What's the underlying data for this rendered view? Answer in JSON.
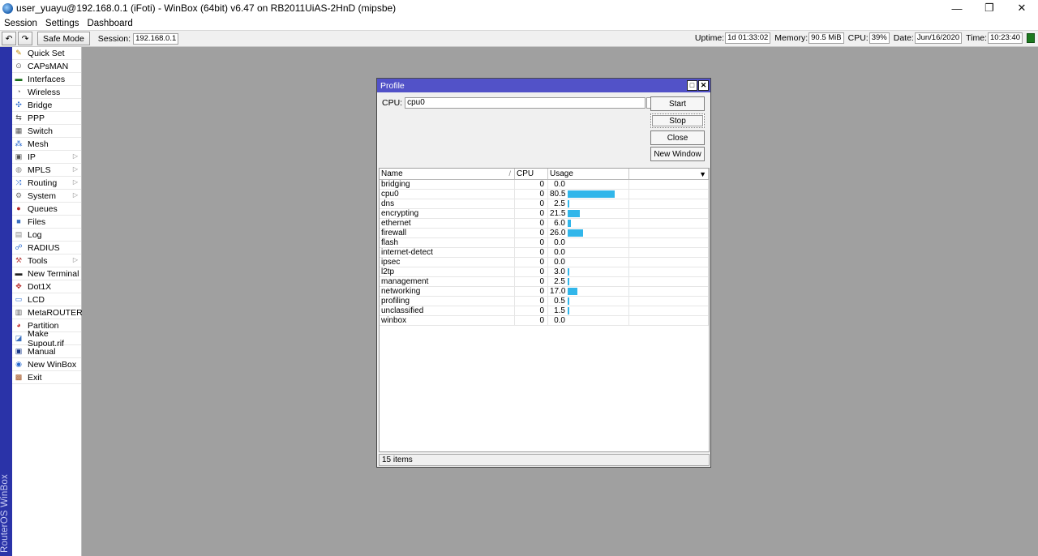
{
  "window": {
    "title": "user_yuayu@192.168.0.1 (iFoti) - WinBox (64bit) v6.47 on RB2011UiAS-2HnD (mipsbe)",
    "minimize": "—",
    "restore": "❐",
    "close": "✕"
  },
  "menu": [
    "Session",
    "Settings",
    "Dashboard"
  ],
  "toolbar": {
    "undo": "↶",
    "redo": "↷",
    "safe_mode": "Safe Mode",
    "session_label": "Session:",
    "session_value": "192.168.0.1",
    "uptime_label": "Uptime:",
    "uptime_value": "1d 01:33:02",
    "memory_label": "Memory:",
    "memory_value": "90.5 MiB",
    "cpu_label": "CPU:",
    "cpu_value": "39%",
    "date_label": "Date:",
    "date_value": "Jun/16/2020",
    "time_label": "Time:",
    "time_value": "10:23:40",
    "status_color": "#1d7a20"
  },
  "brand": "RouterOS WinBox",
  "sidebar": {
    "items": [
      {
        "label": "Quick Set",
        "icon": "wand-icon",
        "glyph": "✎",
        "color": "#c08a00",
        "submenu": false
      },
      {
        "label": "CAPsMAN",
        "icon": "antenna-icon",
        "glyph": "⊙",
        "color": "#666",
        "submenu": false
      },
      {
        "label": "Interfaces",
        "icon": "ethernet-icon",
        "glyph": "▬",
        "color": "#1a6e1a",
        "submenu": false
      },
      {
        "label": "Wireless",
        "icon": "wireless-icon",
        "glyph": "◔",
        "color": "#666",
        "submenu": false
      },
      {
        "label": "Bridge",
        "icon": "bridge-icon",
        "glyph": "✣",
        "color": "#2a6bd0",
        "submenu": false
      },
      {
        "label": "PPP",
        "icon": "ppp-icon",
        "glyph": "⇆",
        "color": "#555",
        "submenu": false
      },
      {
        "label": "Switch",
        "icon": "switch-icon",
        "glyph": "▦",
        "color": "#555",
        "submenu": false
      },
      {
        "label": "Mesh",
        "icon": "mesh-icon",
        "glyph": "⁂",
        "color": "#2a6bd0",
        "submenu": false
      },
      {
        "label": "IP",
        "icon": "ip-icon",
        "glyph": "▣",
        "color": "#555",
        "submenu": true
      },
      {
        "label": "MPLS",
        "icon": "mpls-icon",
        "glyph": "◍",
        "color": "#888",
        "submenu": true
      },
      {
        "label": "Routing",
        "icon": "routing-icon",
        "glyph": "⤨",
        "color": "#2a6bd0",
        "submenu": true
      },
      {
        "label": "System",
        "icon": "gear-icon",
        "glyph": "⚙",
        "color": "#777",
        "submenu": true
      },
      {
        "label": "Queues",
        "icon": "queues-icon",
        "glyph": "●",
        "color": "#b22222",
        "submenu": false
      },
      {
        "label": "Files",
        "icon": "folder-icon",
        "glyph": "■",
        "color": "#3a70c0",
        "submenu": false
      },
      {
        "label": "Log",
        "icon": "log-icon",
        "glyph": "▤",
        "color": "#888",
        "submenu": false
      },
      {
        "label": "RADIUS",
        "icon": "radius-icon",
        "glyph": "☍",
        "color": "#2a6bd0",
        "submenu": false
      },
      {
        "label": "Tools",
        "icon": "tools-icon",
        "glyph": "⚒",
        "color": "#b44",
        "submenu": true
      },
      {
        "label": "New Terminal",
        "icon": "terminal-icon",
        "glyph": "▬",
        "color": "#222",
        "submenu": false
      },
      {
        "label": "Dot1X",
        "icon": "dot1x-icon",
        "glyph": "✥",
        "color": "#b22222",
        "submenu": false
      },
      {
        "label": "LCD",
        "icon": "lcd-icon",
        "glyph": "▭",
        "color": "#2a6bd0",
        "submenu": false
      },
      {
        "label": "MetaROUTER",
        "icon": "metarouter-icon",
        "glyph": "▥",
        "color": "#555",
        "submenu": false
      },
      {
        "label": "Partition",
        "icon": "partition-icon",
        "glyph": "◕",
        "color": "#c03030",
        "submenu": false
      },
      {
        "label": "Make Supout.rif",
        "icon": "supout-icon",
        "glyph": "◪",
        "color": "#3a70c0",
        "submenu": false
      },
      {
        "label": "Manual",
        "icon": "manual-icon",
        "glyph": "▣",
        "color": "#1a3a8a",
        "submenu": false
      },
      {
        "label": "New WinBox",
        "icon": "winbox-icon",
        "glyph": "◉",
        "color": "#2a6bd0",
        "submenu": false
      },
      {
        "label": "Exit",
        "icon": "exit-icon",
        "glyph": "▩",
        "color": "#a05020",
        "submenu": false
      }
    ]
  },
  "profile": {
    "title": "Profile",
    "max_glyph": "□",
    "close_glyph": "✕",
    "cpu_label": "CPU:",
    "cpu_value": "cpu0",
    "dropdown_glyph": "▾",
    "buttons": {
      "start": "Start",
      "stop": "Stop",
      "close": "Close",
      "new_window": "New Window"
    },
    "columns": {
      "name": "Name",
      "cpu": "CPU",
      "usage": "Usage",
      "sort_mark": "/",
      "menu_glyph": "▼"
    },
    "rows": [
      {
        "name": "bridging",
        "cpu": "0",
        "usage": "0.0",
        "pct": 0.0
      },
      {
        "name": "cpu0",
        "cpu": "0",
        "usage": "80.5",
        "pct": 80.5
      },
      {
        "name": "dns",
        "cpu": "0",
        "usage": "2.5",
        "pct": 2.5
      },
      {
        "name": "encrypting",
        "cpu": "0",
        "usage": "21.5",
        "pct": 21.5
      },
      {
        "name": "ethernet",
        "cpu": "0",
        "usage": "6.0",
        "pct": 6.0
      },
      {
        "name": "firewall",
        "cpu": "0",
        "usage": "26.0",
        "pct": 26.0
      },
      {
        "name": "flash",
        "cpu": "0",
        "usage": "0.0",
        "pct": 0.0
      },
      {
        "name": "internet-detect",
        "cpu": "0",
        "usage": "0.0",
        "pct": 0.0
      },
      {
        "name": "ipsec",
        "cpu": "0",
        "usage": "0.0",
        "pct": 0.0
      },
      {
        "name": "l2tp",
        "cpu": "0",
        "usage": "3.0",
        "pct": 3.0
      },
      {
        "name": "management",
        "cpu": "0",
        "usage": "2.5",
        "pct": 2.5
      },
      {
        "name": "networking",
        "cpu": "0",
        "usage": "17.0",
        "pct": 17.0
      },
      {
        "name": "profiling",
        "cpu": "0",
        "usage": "0.5",
        "pct": 0.5
      },
      {
        "name": "unclassified",
        "cpu": "0",
        "usage": "1.5",
        "pct": 1.5
      },
      {
        "name": "winbox",
        "cpu": "0",
        "usage": "0.0",
        "pct": 0.0
      }
    ],
    "status": "15 items"
  }
}
